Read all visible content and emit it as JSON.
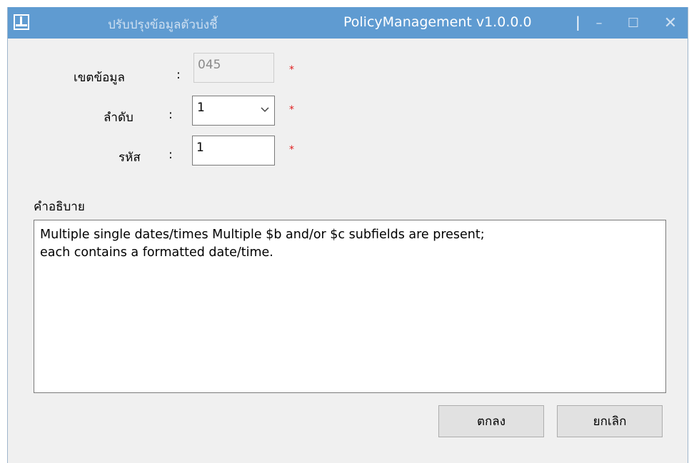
{
  "window": {
    "title": "ปรับปรุงข้อมูลตัวบ่งชี้",
    "app_name": "PolicyManagement v1.0.0.0",
    "separator": "|",
    "min_glyph": "–",
    "max_glyph": "☐",
    "close_glyph": "✕"
  },
  "form": {
    "data_zone": {
      "label": "เขตข้อมูล",
      "colon": ":",
      "value": "045",
      "required": "*",
      "enabled": false
    },
    "sequence": {
      "label": "ลำดับ",
      "colon": ":",
      "value": "1",
      "required": "*"
    },
    "code": {
      "label": "รหัส",
      "colon": ":",
      "value": "1",
      "required": "*"
    },
    "description": {
      "label": "คำอธิบาย",
      "value": "Multiple single dates/times Multiple $b and/or $c subfields are present;\neach contains a formatted date/time."
    }
  },
  "buttons": {
    "ok": "ตกลง",
    "cancel": "ยกเลิก"
  },
  "colors": {
    "titlebar": "#5f9bd1",
    "required": "#e02020",
    "window_bg": "#f0f0f0"
  },
  "icons": {
    "app": "app-window-icon",
    "combo": "chevron-down-icon"
  }
}
